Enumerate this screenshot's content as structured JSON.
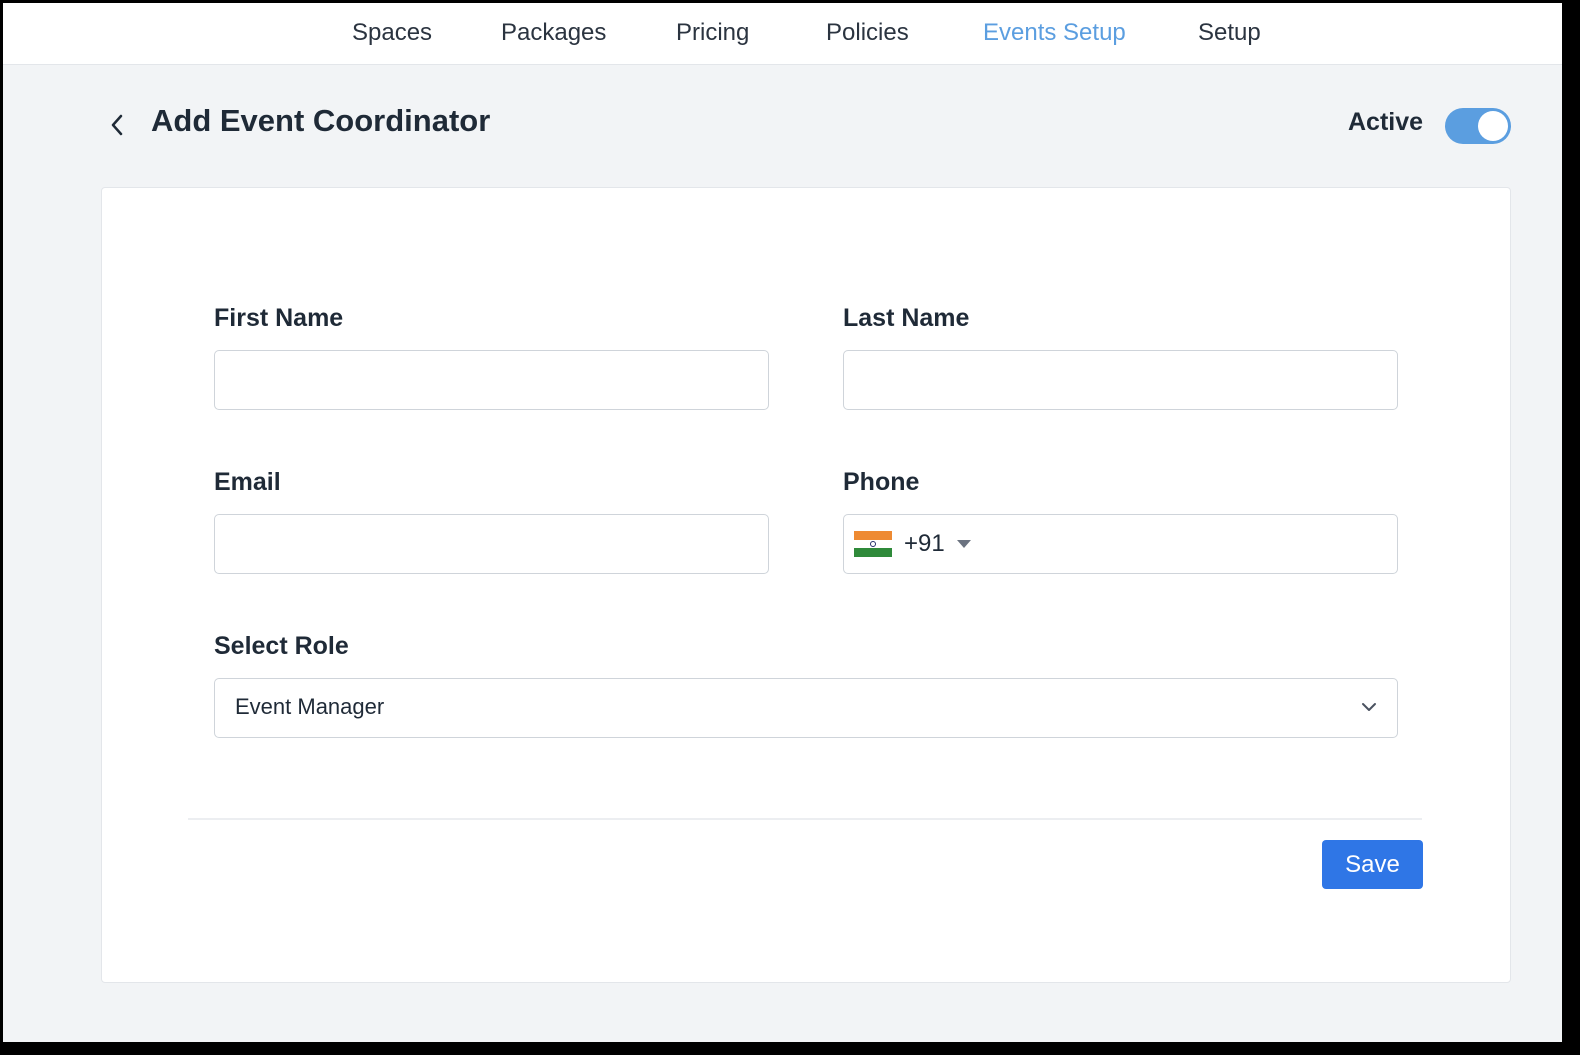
{
  "nav": {
    "tabs": [
      {
        "label": "Spaces"
      },
      {
        "label": "Packages"
      },
      {
        "label": "Pricing"
      },
      {
        "label": "Policies"
      },
      {
        "label": "Events Setup",
        "active": true
      },
      {
        "label": "Setup"
      }
    ]
  },
  "header": {
    "title": "Add Event Coordinator",
    "status_label": "Active",
    "status_enabled": true
  },
  "form": {
    "first_name": {
      "label": "First Name",
      "value": ""
    },
    "last_name": {
      "label": "Last Name",
      "value": ""
    },
    "email": {
      "label": "Email",
      "value": ""
    },
    "phone": {
      "label": "Phone",
      "country_flag": "india-flag-icon",
      "dial_code": "+91",
      "value": ""
    },
    "role": {
      "label": "Select Role",
      "selected": "Event Manager"
    }
  },
  "actions": {
    "save_label": "Save"
  },
  "colors": {
    "accent": "#5b9ee0",
    "primary_button": "#2f76e6",
    "background": "#f2f4f6"
  }
}
